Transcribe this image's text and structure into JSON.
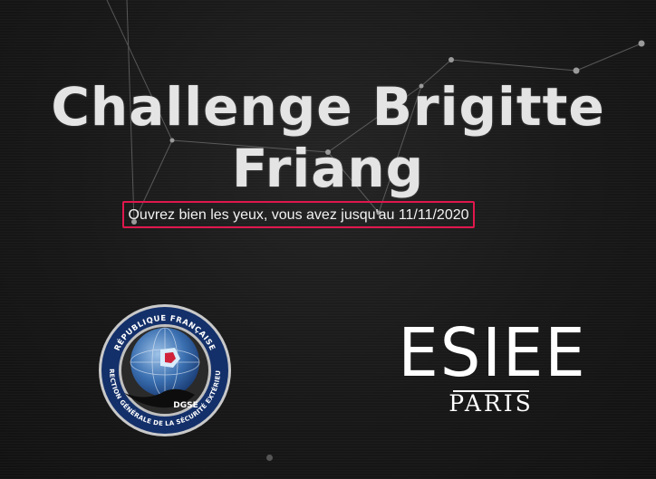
{
  "hero": {
    "title_line1": "Challenge Brigitte",
    "title_line2": "Friang",
    "subtitle": "Ouvrez bien les yeux, vous avez jusqu'au 11/11/2020",
    "highlight_color": "#e0174d"
  },
  "logos": {
    "dgse": {
      "ring_text": "RÉPUBLIQUE FRANÇAISE · DIRECTION GÉNÉRALE DE LA SÉCURITÉ EXTÉRIEURE",
      "center_text": "DGSE"
    },
    "esiee": {
      "wordmark": "ESIEE",
      "subtext": "PARIS"
    }
  },
  "colors": {
    "background": "#161616",
    "text": "#e4e4e4",
    "dgse_ring": "#14306a"
  }
}
